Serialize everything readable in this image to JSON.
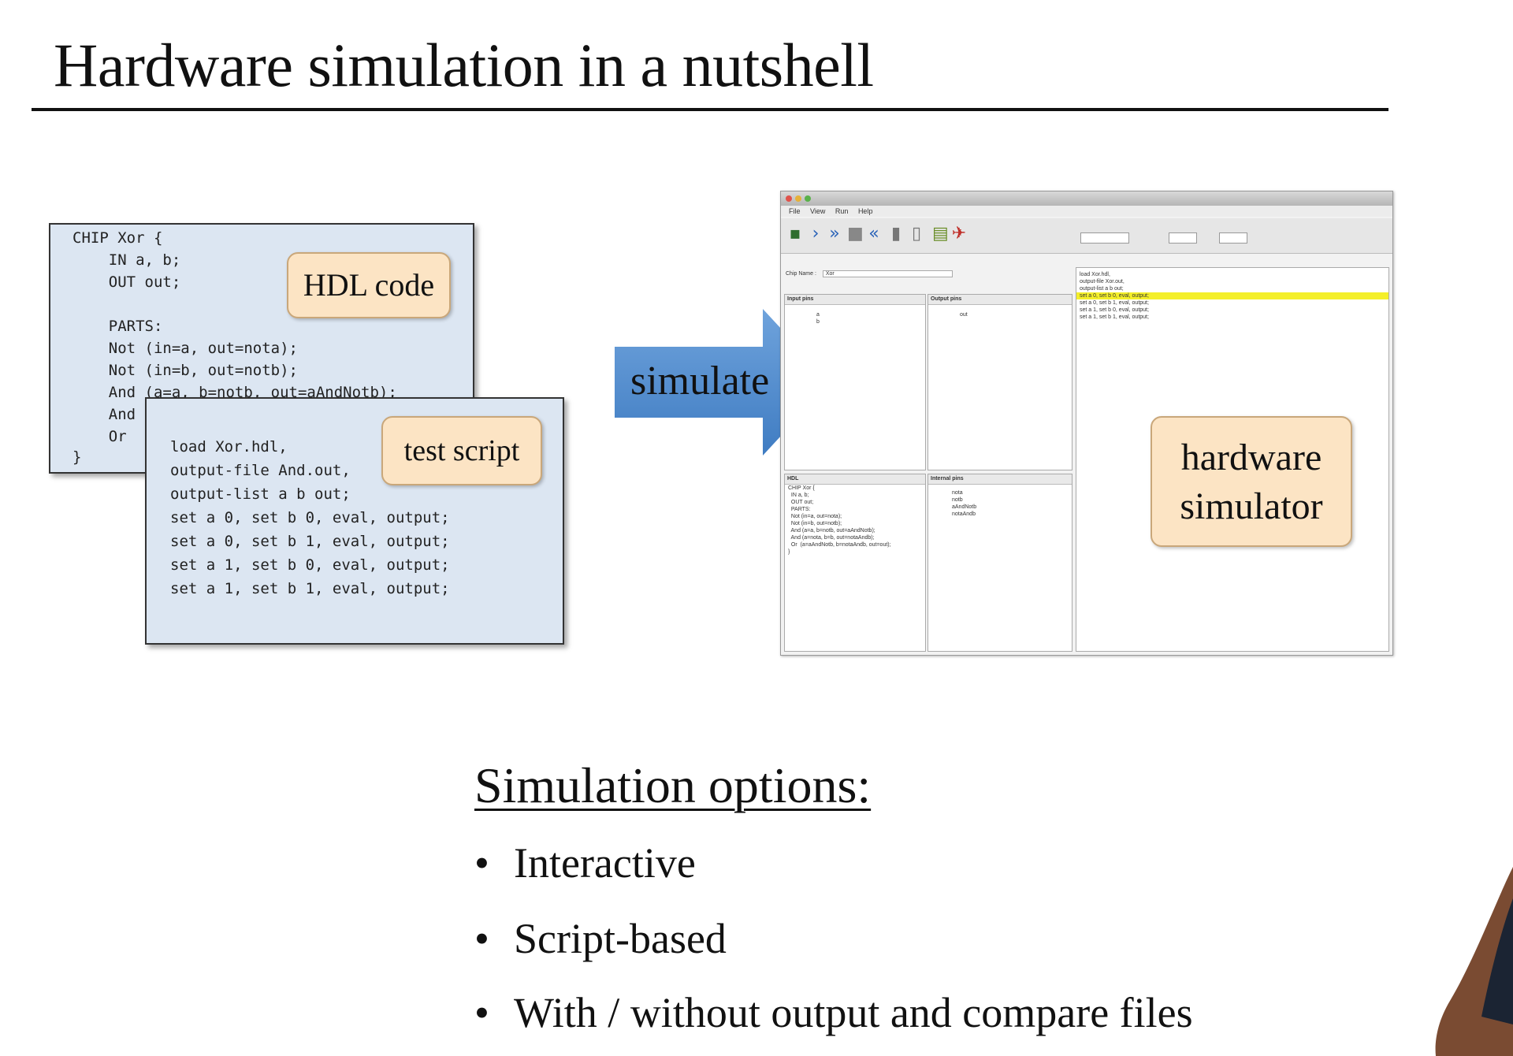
{
  "slide": {
    "title": "Hardware simulation in a nutshell"
  },
  "hdl_code": {
    "label": "HDL code",
    "lines": [
      "CHIP Xor {",
      "    IN a, b;",
      "    OUT out;",
      "",
      "    PARTS:",
      "    Not (in=a, out=nota);",
      "    Not (in=b, out=notb);",
      "    And (a=a, b=notb, out=aAndNotb);",
      "    And (",
      "    Or  (",
      "}"
    ]
  },
  "test_script": {
    "label": "test script",
    "lines": [
      "load Xor.hdl,",
      "output-file And.out,",
      "output-list a b out;",
      "set a 0, set b 0, eval, output;",
      "set a 0, set b 1, eval, output;",
      "set a 1, set b 0, eval, output;",
      "set a 1, set b 1, eval, output;"
    ]
  },
  "arrow": {
    "label": "simulate",
    "color": "#4a86c8"
  },
  "simulator": {
    "label_line1": "hardware",
    "label_line2": "simulator",
    "menu": [
      "File",
      "View",
      "Run",
      "Help"
    ],
    "chip_name_label": "Chip Name :",
    "chip_name_value": "Xor",
    "input_pins_header": "Input pins",
    "output_pins_header": "Output pins",
    "hdl_header": "HDL",
    "internal_pins_header": "Internal pins",
    "script_lines": [
      "load Xor.hdl,",
      "output-file Xor.out,",
      "output-list a b out;",
      "",
      "set a 0, set b 0, eval, output;",
      "set a 0, set b 1, eval, output;",
      "set a 1, set b 0, eval, output;",
      "set a 1, set b 1, eval, output;"
    ],
    "highlighted_line_index": 4,
    "input_pins": [
      "a",
      "b"
    ],
    "output_pins": [
      "out"
    ],
    "internal_pins": [
      "nota",
      "notb",
      "aAndNotb",
      "notaAndb"
    ],
    "hdl_lines": [
      "CHIP Xor {",
      "  IN a, b;",
      "  OUT out;",
      "",
      "  PARTS:",
      "  Not (in=a, out=nota);",
      "  Not (in=b, out=notb);",
      "  And (a=a, b=notb, out=aAndNotb);",
      "  And (a=nota, b=b, out=notaAndb);",
      "  Or  (a=aAndNotb, b=notaAndb, out=out);",
      "}"
    ],
    "colors": {
      "highlight": "#f4ef2a"
    }
  },
  "options": {
    "title": "Simulation options:",
    "items": [
      "Interactive",
      "Script-based",
      "With / without output and compare  files"
    ]
  }
}
